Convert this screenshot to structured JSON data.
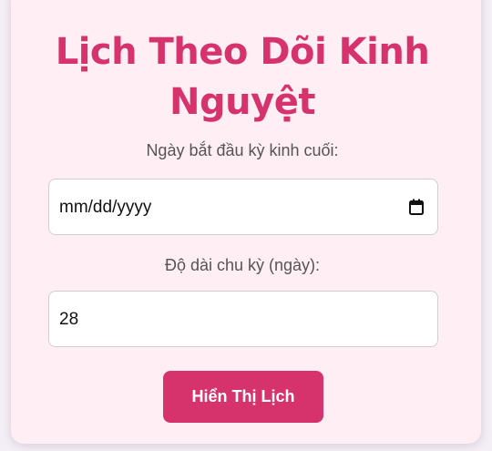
{
  "page": {
    "title": "Lịch Theo Dõi Kinh Nguyệt"
  },
  "form": {
    "start_date_label": "Ngày bắt đầu kỳ kinh cuối:",
    "start_date_placeholder": "mm/dd/yyyy",
    "cycle_length_label": "Độ dài chu kỳ (ngày):",
    "cycle_length_value": "28",
    "submit_label": "Hiển Thị Lịch"
  },
  "icons": {
    "date_picker": "calendar-icon"
  },
  "colors": {
    "accent": "#d6336c",
    "card_background": "#ffeef3",
    "label_text": "#555555"
  }
}
